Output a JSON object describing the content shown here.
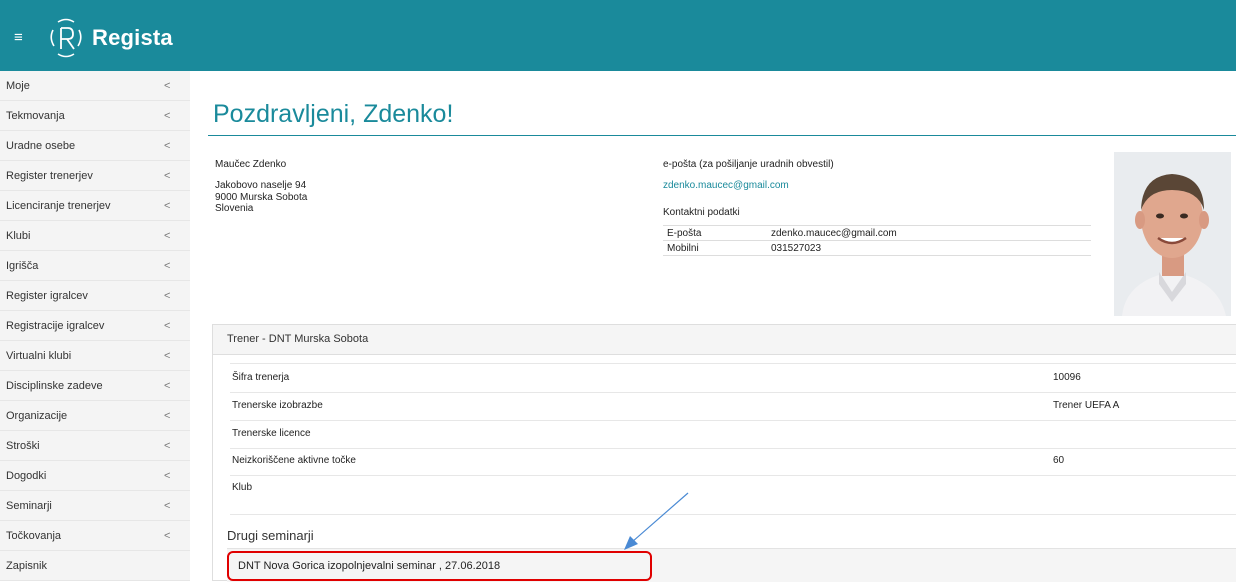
{
  "app": {
    "name": "Regista"
  },
  "sidebar": {
    "items": [
      {
        "label": "Moje"
      },
      {
        "label": "Tekmovanja"
      },
      {
        "label": "Uradne osebe"
      },
      {
        "label": "Register trenerjev"
      },
      {
        "label": "Licenciranje trenerjev"
      },
      {
        "label": "Klubi"
      },
      {
        "label": "Igrišča"
      },
      {
        "label": "Register igralcev"
      },
      {
        "label": "Registracije igralcev"
      },
      {
        "label": "Virtualni klubi"
      },
      {
        "label": "Disciplinske zadeve"
      },
      {
        "label": "Organizacije"
      },
      {
        "label": "Stroški"
      },
      {
        "label": "Dogodki"
      },
      {
        "label": "Seminarji"
      },
      {
        "label": "Točkovanja"
      },
      {
        "label": "Zapisnik"
      }
    ],
    "chevron": "<"
  },
  "main": {
    "greeting": "Pozdravljeni, Zdenko!",
    "person": {
      "name": "Maučec Zdenko",
      "street": "Jakobovo naselje 94",
      "city": "9000 Murska Sobota",
      "country": "Slovenia"
    },
    "email_section": {
      "label": "e-pošta (za pošiljanje uradnih obvestil)",
      "email": "zdenko.maucec@gmail.com"
    },
    "contacts": {
      "title": "Kontaktni podatki",
      "rows": [
        {
          "key": "E-pošta",
          "value": "zdenko.maucec@gmail.com"
        },
        {
          "key": "Mobilni",
          "value": "031527023"
        }
      ]
    },
    "coach_panel": {
      "title": "Trener - DNT Murska Sobota",
      "rows": [
        {
          "label": "Šifra trenerja",
          "value": "10096"
        },
        {
          "label": "Trenerske izobrazbe",
          "value": "Trener UEFA A"
        },
        {
          "label": "Trenerske licence",
          "value": ""
        },
        {
          "label": "Neizkoriščene aktivne točke",
          "value": "60"
        },
        {
          "label": "Klub",
          "value": ""
        }
      ]
    },
    "seminars": {
      "title": "Drugi seminarji",
      "item": "DNT Nova Gorica izopolnjevalni seminar , 27.06.2018"
    }
  },
  "colors": {
    "brand": "#1a8a9b",
    "highlight": "#e00000",
    "annotation_arrow": "#4a8ad4"
  }
}
